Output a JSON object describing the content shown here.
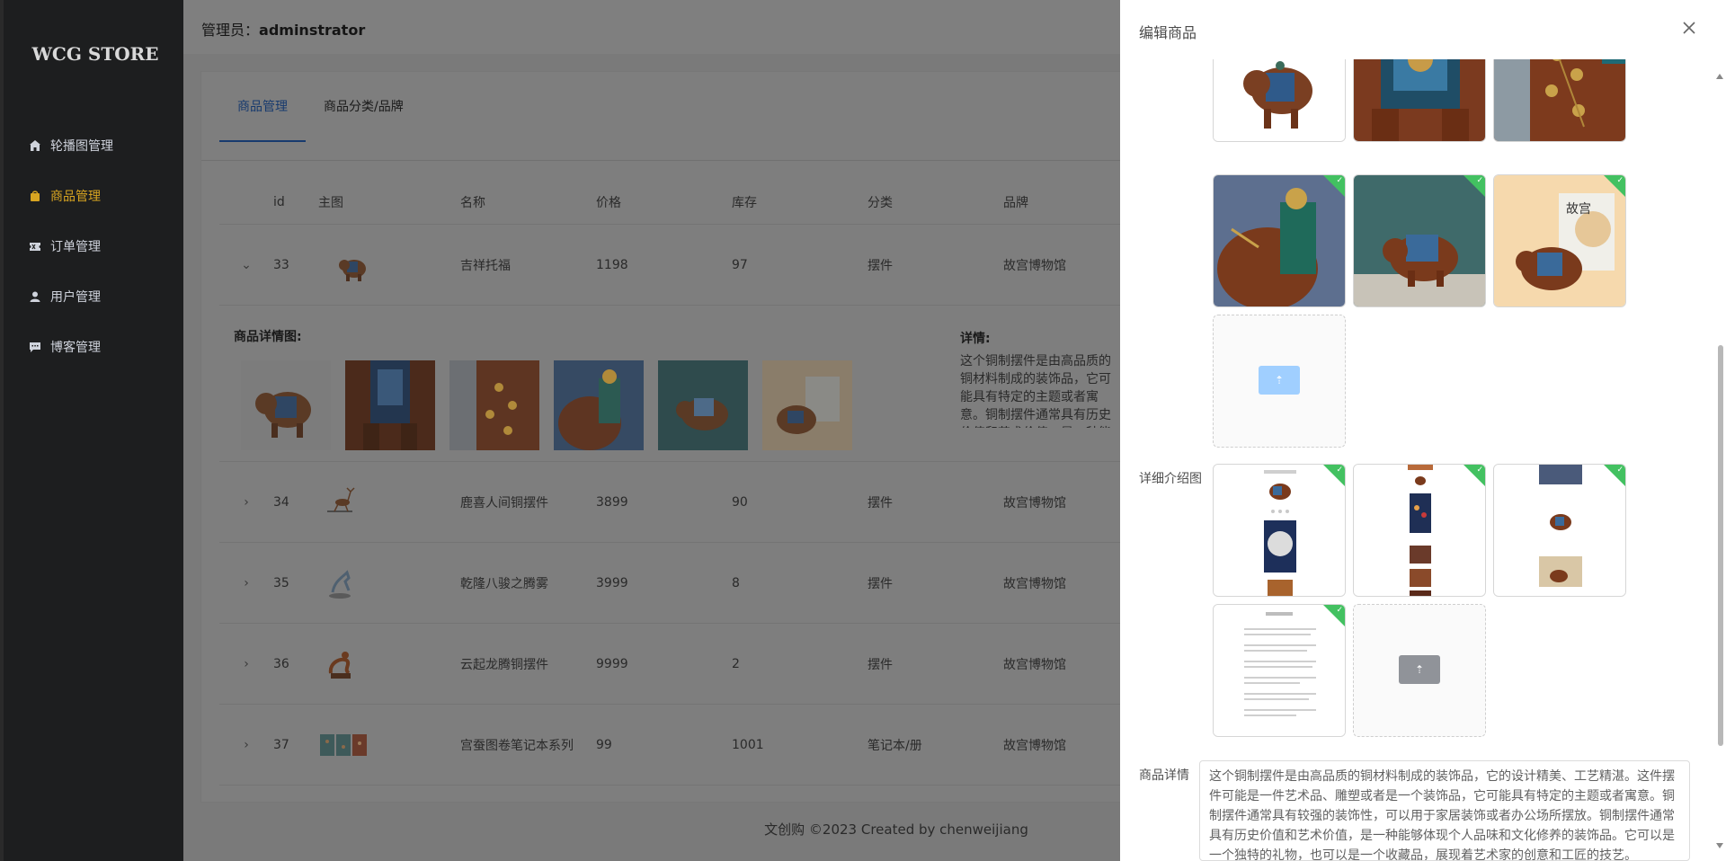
{
  "sidebar": {
    "logo": "WCG STORE",
    "items": [
      {
        "label": "轮播图管理",
        "icon": "home-icon"
      },
      {
        "label": "商品管理",
        "icon": "bag-icon"
      },
      {
        "label": "订单管理",
        "icon": "ticket-icon"
      },
      {
        "label": "用户管理",
        "icon": "user-icon"
      },
      {
        "label": "博客管理",
        "icon": "chat-icon"
      }
    ],
    "active_index": 1,
    "active_color": "#d9a521"
  },
  "header": {
    "admin_prefix": "管理员：",
    "admin_name": "adminstrator"
  },
  "tabs": [
    "商品管理",
    "商品分类/品牌"
  ],
  "table": {
    "columns": [
      "id",
      "主图",
      "名称",
      "价格",
      "库存",
      "分类",
      "品牌"
    ],
    "rows": [
      {
        "id": "33",
        "name": "吉祥托福",
        "price": "1198",
        "stock": "97",
        "category": "摆件",
        "brand": "故宫博物馆",
        "expanded": true
      },
      {
        "id": "34",
        "name": "鹿喜人间铜摆件",
        "price": "3899",
        "stock": "90",
        "category": "摆件",
        "brand": "故宫博物馆",
        "expanded": false
      },
      {
        "id": "35",
        "name": "乾隆八骏之腾雾",
        "price": "3999",
        "stock": "8",
        "category": "摆件",
        "brand": "故宫博物馆",
        "expanded": false
      },
      {
        "id": "36",
        "name": "云起龙腾铜摆件",
        "price": "9999",
        "stock": "2",
        "category": "摆件",
        "brand": "故宫博物馆",
        "expanded": false
      },
      {
        "id": "37",
        "name": "宫蚕图卷笔记本系列",
        "price": "99",
        "stock": "1001",
        "category": "笔记本/册",
        "brand": "故宫博物馆",
        "expanded": false
      }
    ],
    "expand": {
      "images_title": "商品详情图:",
      "detail_title": "详情:",
      "detail_text": "这个铜制摆件是由高品质的铜材料制成的装饰品，它可能具有特定的主题或者寓意。铜制摆件通常具有历史价值和艺术价值，是一种能够体现个人品味和文化修养的装饰品。它可以是一个独特的礼物，也可以是一个收藏品，展现着艺术家的创意和工匠的技艺。"
    }
  },
  "footer": "文创购 ©2023 Created by chenweijiang",
  "drawer": {
    "title": "编辑商品",
    "detail_images_label": "详细介绍图",
    "desc_label": "商品详情",
    "desc_text": "这个铜制摆件是由高品质的铜材料制成的装饰品，它的设计精美、工艺精湛。这件摆件可能是一件艺术品、雕塑或者是一个装饰品，它可能具有特定的主题或者寓意。铜制摆件通常具有较强的装饰性，可以用于家居装饰或者办公场所摆放。铜制摆件通常具有历史价值和艺术价值，是一种能够体现个人品味和文化修养的装饰品。它可以是一个独特的礼物，也可以是一个收藏品，展现着艺术家的创意和工匠的技艺。",
    "upload_icon": "upload-icon",
    "success_color": "#43c161"
  }
}
